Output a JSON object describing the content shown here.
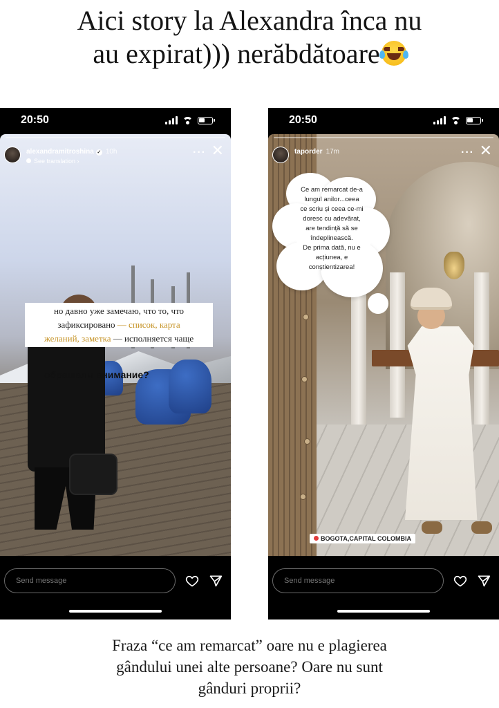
{
  "headline": {
    "line1": "Aici story la Alexandra înca nu",
    "line2": "au expirat))) nerăbdătoare"
  },
  "caption": {
    "line1": "Fraza “ce am remarcat” oare nu e plagierea",
    "line2": "gândului unei alte persoane? Oare nu sunt",
    "line3": "gânduri proprii?"
  },
  "left_story": {
    "status_time": "20:50",
    "username": "alexandramitroshina",
    "time_ago": "10h",
    "see_translation": "See translation ›",
    "more_label": "···",
    "close_label": "✕",
    "text_line1": "но давно уже замечаю, что то, что",
    "text_line2a": "зафиксировано",
    "text_line2b": "— список, карта",
    "text_line3a": "желаний, заметка",
    "text_line3b": "— исполняется чаще",
    "question": "обращали внимание?",
    "send_message_placeholder": "Send message"
  },
  "right_story": {
    "status_time": "20:50",
    "username": "taporder",
    "time_ago": "17m",
    "more_label": "···",
    "close_label": "✕",
    "cloud_line1": "Ce am remarcat de-a",
    "cloud_line2": "lungul anilor...ceea",
    "cloud_line3": "ce scriu și ceea ce-mi",
    "cloud_line4": "doresc cu adevărat,",
    "cloud_line5": "are tendință să se",
    "cloud_line6": "îndeplinească.",
    "cloud_line7": "De prima dată, nu e",
    "cloud_line8": "acțiunea, e",
    "cloud_line9": "conștientizarea!",
    "location": "BOGOTA,CAPITAL COLOMBIA",
    "send_message_placeholder": "Send message"
  },
  "icons": {
    "heart": "heart-icon",
    "send": "send-icon",
    "close": "close-icon",
    "more": "more-options-icon",
    "emoji": "laughing-tears-emoji"
  },
  "colors": {
    "highlight_text": "#c59224",
    "story_bg": "#000000",
    "tag_pin": "#e23b3b"
  }
}
